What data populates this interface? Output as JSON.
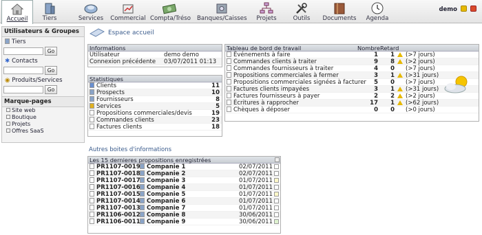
{
  "topbar": {
    "menu": [
      {
        "label": "Accueil",
        "icon": "home-icon"
      },
      {
        "label": "Tiers",
        "icon": "building-icon"
      },
      {
        "label": "Services",
        "icon": "services-icon"
      },
      {
        "label": "Commercial",
        "icon": "commercial-icon"
      },
      {
        "label": "Compta/Tréso",
        "icon": "money-icon"
      },
      {
        "label": "Banques/Caisses",
        "icon": "safe-icon"
      },
      {
        "label": "Projets",
        "icon": "projects-icon"
      },
      {
        "label": "Outils",
        "icon": "tools-icon"
      },
      {
        "label": "Documents",
        "icon": "documents-icon"
      },
      {
        "label": "Agenda",
        "icon": "clock-icon"
      }
    ],
    "user": "demo"
  },
  "sidebar": {
    "header": "Utilisateurs & Groupes",
    "searches": [
      {
        "label": "Tiers",
        "go": "Go"
      },
      {
        "label": "Contacts",
        "go": "Go"
      },
      {
        "label": "Produits/Services",
        "go": "Go"
      }
    ],
    "bookmarks_title": "Marque-pages",
    "bookmarks": [
      "Site web",
      "Boutique",
      "Projets",
      "Offres SaaS"
    ]
  },
  "main": {
    "espace_title": "Espace accueil",
    "informations": {
      "title": "Informations",
      "rows": [
        {
          "label": "Utilisateur",
          "value": "demo demo"
        },
        {
          "label": "Connexion précédente",
          "value": "03/07/2011 01:13"
        }
      ]
    },
    "statistiques": {
      "title": "Statistiques",
      "rows": [
        {
          "label": "Clients",
          "value": "11"
        },
        {
          "label": "Prospects",
          "value": "10"
        },
        {
          "label": "Fournisseurs",
          "value": "8"
        },
        {
          "label": "Services",
          "value": "5"
        },
        {
          "label": "Propositions commerciales/devis",
          "value": "19"
        },
        {
          "label": "Commandes clients",
          "value": "23"
        },
        {
          "label": "Factures clients",
          "value": "18"
        }
      ]
    },
    "tableau": {
      "title": "Tableau de bord de travail",
      "col_nombre": "Nombre",
      "col_retard": "Retard",
      "rows": [
        {
          "label": "Événements à faire",
          "nombre": "1",
          "retard": "1",
          "delai": "(>7 jours)"
        },
        {
          "label": "Commandes clients à traiter",
          "nombre": "9",
          "retard": "8",
          "delai": "(>2 jours)"
        },
        {
          "label": "Commandes fournisseurs à traiter",
          "nombre": "4",
          "retard": "0",
          "delai": "(>7 jours)"
        },
        {
          "label": "Propositions commerciales à fermer",
          "nombre": "3",
          "retard": "1",
          "delai": "(>31 jours)"
        },
        {
          "label": "Propositions commerciales signées à facturer",
          "nombre": "5",
          "retard": "0",
          "delai": "(>7 jours)"
        },
        {
          "label": "Factures clients impayées",
          "nombre": "3",
          "retard": "1",
          "delai": "(>31 jours)"
        },
        {
          "label": "Factures fournisseurs à payer",
          "nombre": "2",
          "retard": "2",
          "delai": "(>2 jours)"
        },
        {
          "label": "Écritures à rapprocher",
          "nombre": "17",
          "retard": "1",
          "delai": "(>62 jours)"
        },
        {
          "label": "Chèques à déposer",
          "nombre": "0",
          "retard": "0",
          "delai": "(>0 jours)"
        }
      ]
    },
    "autres_title": "Autres boites d'informations",
    "propositions": {
      "title": "Les 15 dernieres propositions enregistrées",
      "rows": [
        {
          "ref": "PR1107-0019",
          "company": "Companie 1",
          "date": "02/07/2011"
        },
        {
          "ref": "PR1107-0018",
          "company": "Companie 2",
          "date": "02/07/2011"
        },
        {
          "ref": "PR1107-0017",
          "company": "Companie 3",
          "date": "01/07/2011"
        },
        {
          "ref": "PR1107-0016",
          "company": "Companie 4",
          "date": "01/07/2011"
        },
        {
          "ref": "PR1107-0015",
          "company": "Companie 5",
          "date": "01/07/2011"
        },
        {
          "ref": "PR1107-0014",
          "company": "Companie 6",
          "date": "01/07/2011"
        },
        {
          "ref": "PR1107-0013",
          "company": "Companie 7",
          "date": "01/07/2011"
        },
        {
          "ref": "PR1106-0012",
          "company": "Companie 8",
          "date": "30/06/2011"
        },
        {
          "ref": "PR1106-0011",
          "company": "Companie 9",
          "date": "30/06/2011"
        }
      ]
    }
  }
}
